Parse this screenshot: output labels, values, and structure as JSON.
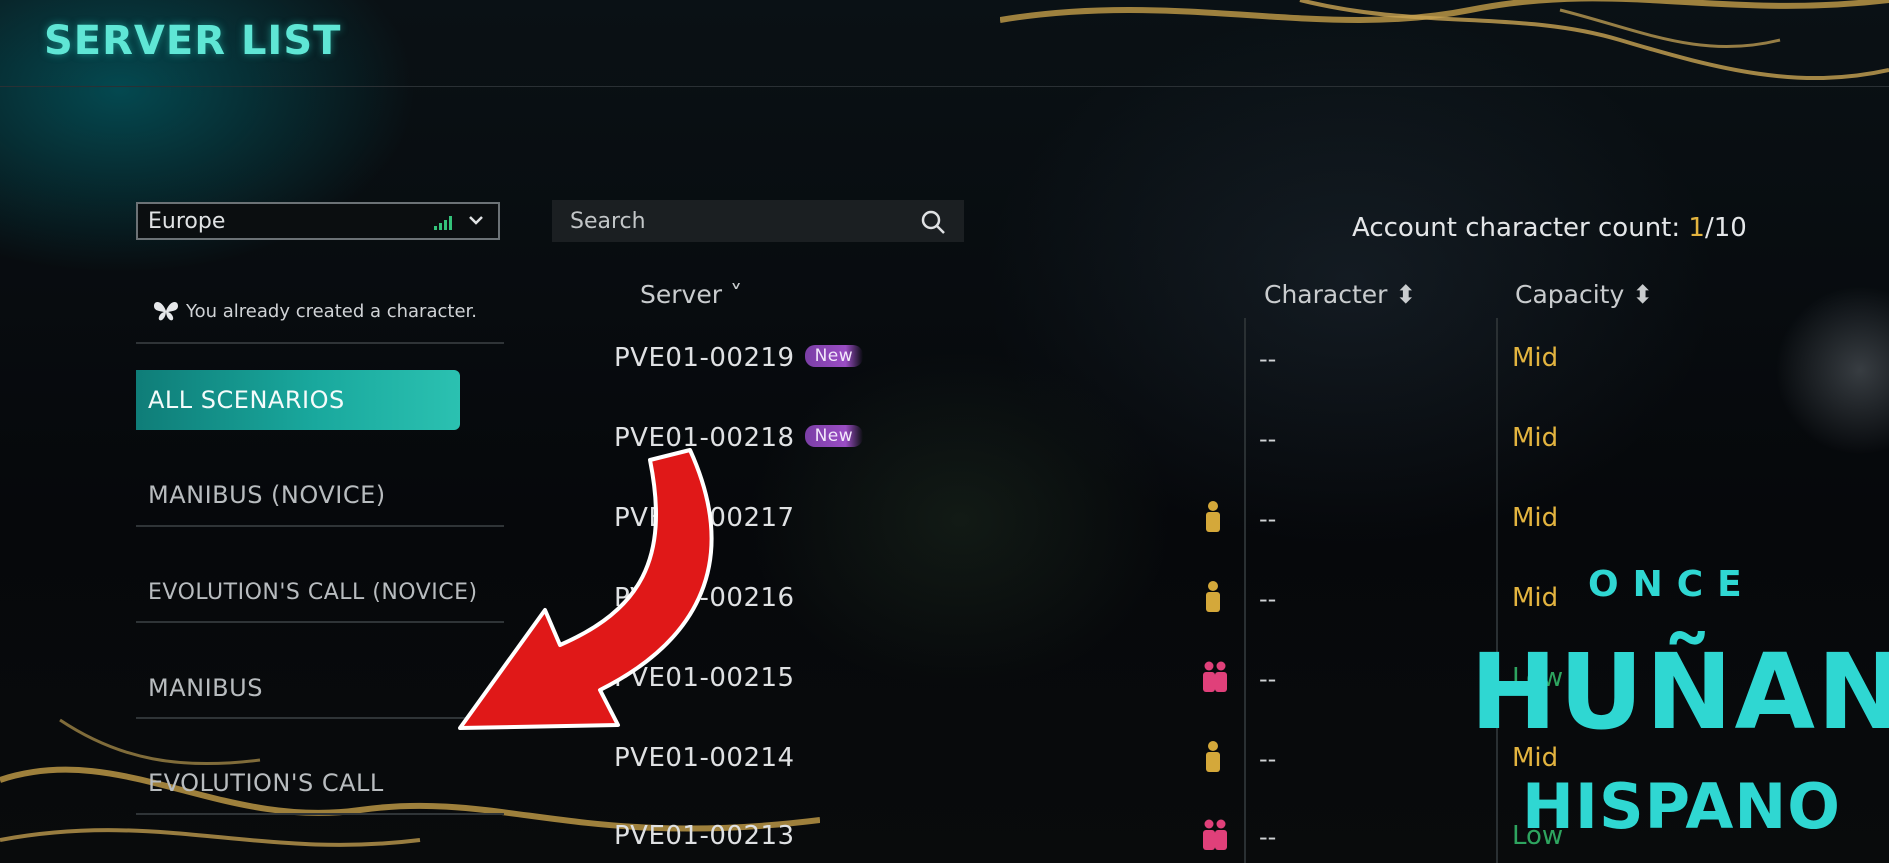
{
  "header": {
    "title": "SERVER LIST"
  },
  "region": {
    "selected": "Europe"
  },
  "notice": {
    "text": "You already created a character."
  },
  "scenarios": [
    {
      "label": "ALL SCENARIOS",
      "active": true
    },
    {
      "label": "MANIBUS (NOVICE)",
      "active": false
    },
    {
      "label": "EVOLUTION'S CALL (NOVICE)",
      "active": false
    },
    {
      "label": "MANIBUS",
      "active": false
    },
    {
      "label": "EVOLUTION'S CALL",
      "active": false
    }
  ],
  "search": {
    "placeholder": "Search"
  },
  "account": {
    "label": "Account character count: ",
    "current": "1",
    "max": "/10"
  },
  "table": {
    "headers": {
      "server": "Server ˅",
      "character": "Character ⬍",
      "capacity": "Capacity ⬍"
    },
    "rows": [
      {
        "server": "PVE01-00219",
        "badge": "New",
        "character": "--",
        "capacity": "Mid",
        "cap_color": "#e3b43f",
        "friend_icon": ""
      },
      {
        "server": "PVE01-00218",
        "badge": "New",
        "character": "--",
        "capacity": "Mid",
        "cap_color": "#e3b43f",
        "friend_icon": ""
      },
      {
        "server": "PVE01-00217",
        "badge": "",
        "character": "--",
        "capacity": "Mid",
        "cap_color": "#e3b43f",
        "friend_icon": "yellow-person-icon"
      },
      {
        "server": "PVE01-00216",
        "badge": "",
        "character": "--",
        "capacity": "Mid",
        "cap_color": "#e3b43f",
        "friend_icon": "yellow-person-icon"
      },
      {
        "server": "PVE01-00215",
        "badge": "",
        "character": "--",
        "capacity": "Low",
        "cap_color": "#2ea45f",
        "friend_icon": "pink-people-icon"
      },
      {
        "server": "PVE01-00214",
        "badge": "",
        "character": "--",
        "capacity": "Mid",
        "cap_color": "#e3b43f",
        "friend_icon": "yellow-person-icon"
      },
      {
        "server": "PVE01-00213",
        "badge": "",
        "character": "--",
        "capacity": "Low",
        "cap_color": "#2ea45f",
        "friend_icon": "pink-people-icon"
      }
    ]
  },
  "watermark": {
    "line1": "ONCE",
    "line2": "HUÑAN",
    "line3": "HISPANO"
  },
  "colors": {
    "accent": "#5fe6d5",
    "mid": "#e3b43f",
    "low": "#2ea45f",
    "badge": "#9a4dc4",
    "arrow": "#e01818"
  }
}
